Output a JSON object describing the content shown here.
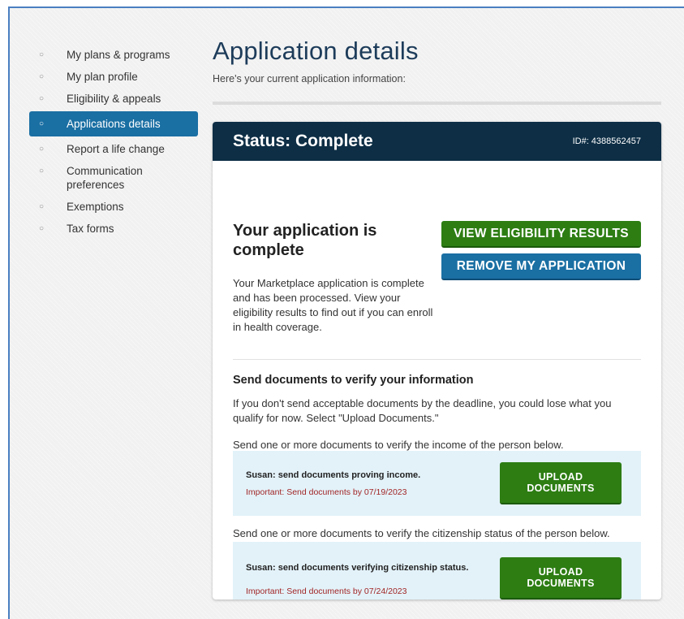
{
  "sidebar": {
    "items": [
      {
        "label": "My plans & programs",
        "active": false
      },
      {
        "label": "My plan profile",
        "active": false
      },
      {
        "label": "Eligibility & appeals",
        "active": false
      },
      {
        "label": "Applications details",
        "active": true
      },
      {
        "label": "Report a life change",
        "active": false
      },
      {
        "label": "Communication preferences",
        "active": false
      },
      {
        "label": "Exemptions",
        "active": false
      },
      {
        "label": "Tax forms",
        "active": false
      }
    ]
  },
  "main": {
    "title": "Application details",
    "subtitle": "Here's your current application information:"
  },
  "status_card": {
    "status": "Status: Complete",
    "id": "ID#: 4388562457",
    "heading": "Your application is complete",
    "description": "Your Marketplace application is complete and has been processed. View your eligibility results to find out if you can enroll in health coverage.",
    "view_button": "VIEW ELIGIBILITY RESULTS",
    "remove_button": "REMOVE MY APPLICATION"
  },
  "documents": {
    "heading": "Send documents to verify your information",
    "description": "If you don't send acceptable documents by the deadline, you could lose what you qualify for now. Select \"Upload Documents.\"",
    "requests": [
      {
        "intro": "Send one or more documents to verify the income of the person below.",
        "title": "Susan: send documents proving income.",
        "deadline": "Important: Send documents by 07/19/2023",
        "button": "UPLOAD DOCUMENTS"
      },
      {
        "intro": "Send one or more documents to verify the citizenship status of the person below.",
        "title": "Susan: send documents verifying citizenship status.",
        "deadline": "Important: Send documents by 07/24/2023",
        "button": "UPLOAD DOCUMENTS"
      }
    ]
  },
  "colors": {
    "header_bg": "#0d2e45",
    "active_nav": "#1a6fa3",
    "primary_green": "#2d7d13",
    "primary_blue": "#1a6fa3",
    "deadline_red": "#a12626",
    "doc_box_bg": "#e3f2f9"
  },
  "icons": {
    "nav_bullet": "circle-bullet-icon"
  }
}
